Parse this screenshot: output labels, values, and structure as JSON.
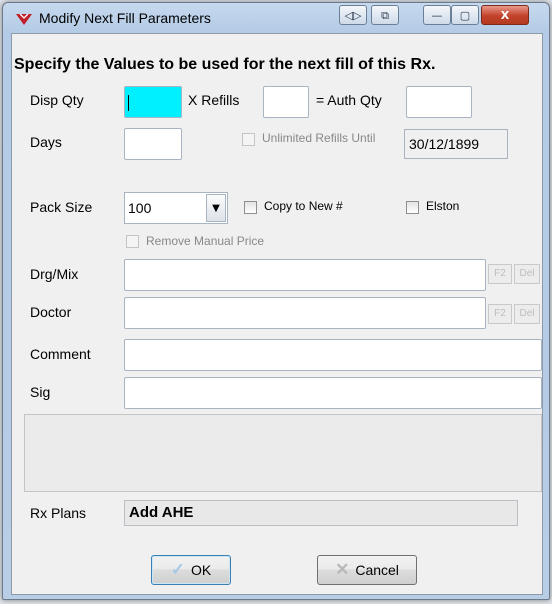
{
  "window": {
    "title": "Modify Next Fill Parameters",
    "controls": {
      "extra1": "◁▷",
      "extra2": "⧉",
      "minimize": "—",
      "maximize": "▢",
      "close": "X"
    }
  },
  "heading": "Specify the Values to be used for the next fill of this Rx.",
  "quantities": {
    "disp_qty_label": "Disp Qty",
    "disp_qty_value": "",
    "refills_label": "X Refills",
    "refills_value": "",
    "auth_qty_label": "= Auth Qty",
    "auth_qty_value": "",
    "days_label": "Days",
    "days_value": "",
    "unlimited_label": "Unlimited Refills Until",
    "unlimited_checked": false,
    "unlimited_date": "30/12/1899"
  },
  "pack": {
    "label": "Pack Size",
    "value": "100",
    "copy_label": "Copy to New #",
    "copy_checked": false,
    "elston_label": "Elston",
    "elston_checked": false,
    "remove_manual_label": "Remove Manual Price",
    "remove_manual_checked": false
  },
  "drg_mix": {
    "label": "Drg/Mix",
    "value": "",
    "f2_label": "F2",
    "del_label": "Del"
  },
  "doctor": {
    "label": "Doctor",
    "value": "",
    "f2_label": "F2",
    "del_label": "Del"
  },
  "comment": {
    "label": "Comment",
    "value": ""
  },
  "sig": {
    "label": "Sig",
    "value": ""
  },
  "rx_plans": {
    "label": "Rx Plans",
    "value": "Add AHE"
  },
  "buttons": {
    "ok": "OK",
    "cancel": "Cancel"
  },
  "colors": {
    "active_field": "#00f0ff",
    "titlebar": "#b9cfe8",
    "close_button": "#c2412a"
  }
}
